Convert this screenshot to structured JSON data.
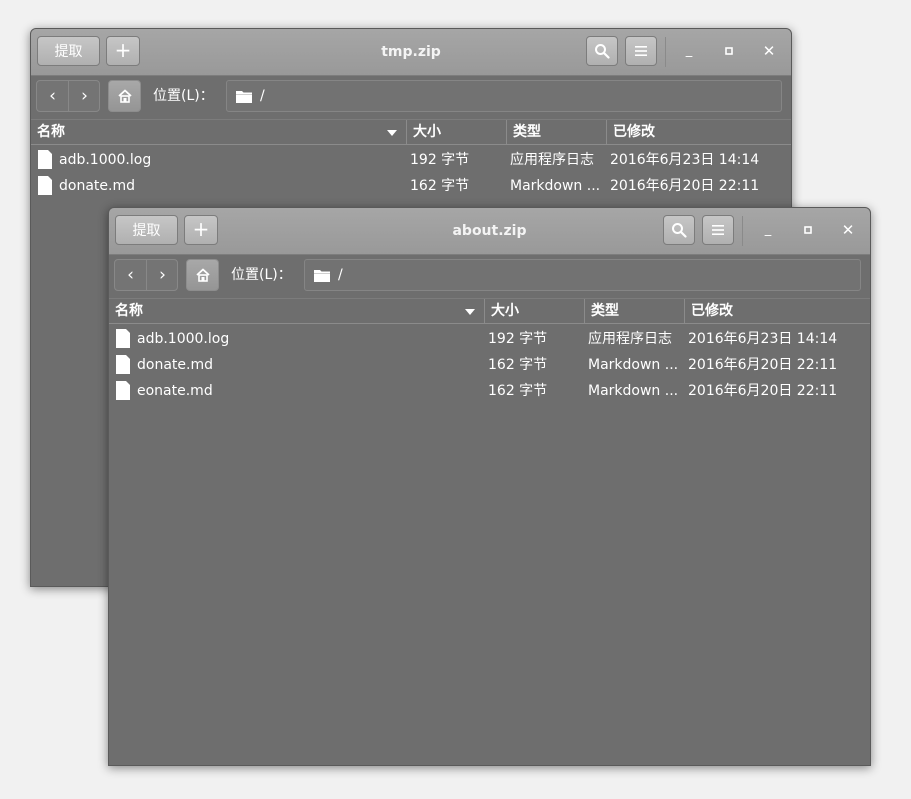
{
  "windows": [
    {
      "title": "tmp.zip",
      "extract_label": "提取",
      "add_label": "+",
      "location_label": "位置(L)：",
      "location_path": "/",
      "columns": {
        "name": "名称",
        "size": "大小",
        "type": "类型",
        "modified": "已修改"
      },
      "files": [
        {
          "name": "adb.1000.log",
          "size": "192 字节",
          "type": "应用程序日志",
          "modified": "2016年6月23日 14:14"
        },
        {
          "name": "donate.md",
          "size": "162 字节",
          "type": "Markdown ...",
          "modified": "2016年6月20日 22:11"
        }
      ]
    },
    {
      "title": "about.zip",
      "extract_label": "提取",
      "add_label": "+",
      "location_label": "位置(L)：",
      "location_path": "/",
      "columns": {
        "name": "名称",
        "size": "大小",
        "type": "类型",
        "modified": "已修改"
      },
      "files": [
        {
          "name": "adb.1000.log",
          "size": "192 字节",
          "type": "应用程序日志",
          "modified": "2016年6月23日 14:14"
        },
        {
          "name": "donate.md",
          "size": "162 字节",
          "type": "Markdown ...",
          "modified": "2016年6月20日 22:11"
        },
        {
          "name": "eonate.md",
          "size": "162 字节",
          "type": "Markdown ...",
          "modified": "2016年6月20日 22:11"
        }
      ]
    }
  ],
  "icons": {
    "search": "search-icon",
    "menu": "hamburger-menu-icon",
    "back": "chevron-left-icon",
    "forward": "chevron-right-icon",
    "home": "home-icon",
    "folder": "folder-icon",
    "file": "file-icon",
    "minimize": "minimize-icon",
    "maximize": "maximize-icon",
    "close": "close-icon"
  },
  "colors": {
    "window_bg": "#6e6e6e",
    "headerbar": "#a0a0a0",
    "desktop": "#f1f1f1",
    "text": "#ffffff"
  }
}
